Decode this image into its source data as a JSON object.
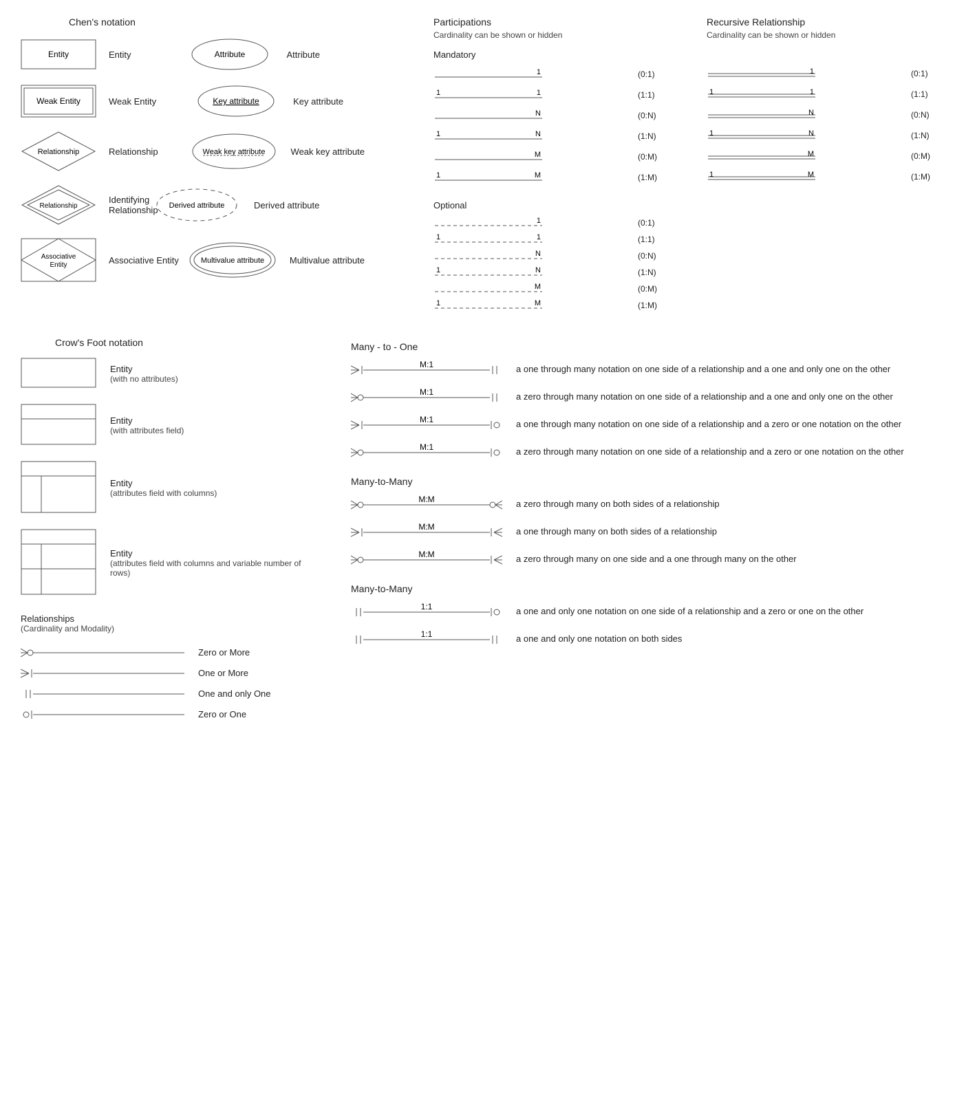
{
  "chen": {
    "title": "Chen's notation",
    "items": [
      {
        "shape_text": "Entity",
        "label": "Entity"
      },
      {
        "shape_text": "Weak Entity",
        "label": "Weak Entity"
      },
      {
        "shape_text": "Relationship",
        "label": "Relationship"
      },
      {
        "shape_text": "Relationship",
        "label": "Identifying Relationship"
      },
      {
        "shape_text": "Associative\nEntity",
        "label": "Associative Entity"
      }
    ],
    "attrs": [
      {
        "shape_text": "Attribute",
        "label": "Attribute"
      },
      {
        "shape_text": "Key attribute",
        "label": "Key attribute"
      },
      {
        "shape_text": "Weak key attribute",
        "label": "Weak key attribute"
      },
      {
        "shape_text": "Derived attribute",
        "label": "Derived attribute"
      },
      {
        "shape_text": "Multivalue attribute",
        "label": "Multivalue attribute"
      }
    ]
  },
  "participations": {
    "title": "Participations",
    "subtitle": "Cardinality can be shown or hidden",
    "mandatory_title": "Mandatory",
    "optional_title": "Optional",
    "rows": [
      {
        "left": "",
        "right": "1",
        "card": "(0:1)"
      },
      {
        "left": "1",
        "right": "1",
        "card": "(1:1)"
      },
      {
        "left": "",
        "right": "N",
        "card": "(0:N)"
      },
      {
        "left": "1",
        "right": "N",
        "card": "(1:N)"
      },
      {
        "left": "",
        "right": "M",
        "card": "(0:M)"
      },
      {
        "left": "1",
        "right": "M",
        "card": "(1:M)"
      }
    ],
    "opt_rows": [
      {
        "left": "",
        "right": "1",
        "card": "(0:1)"
      },
      {
        "left": "1",
        "right": "1",
        "card": "(1:1)"
      },
      {
        "left": "",
        "right": "N",
        "card": "(0:N)"
      },
      {
        "left": "1",
        "right": "N",
        "card": "(1:N)"
      },
      {
        "left": "",
        "right": "M",
        "card": "(0:M)"
      },
      {
        "left": "1",
        "right": "M",
        "card": "(1:M)"
      }
    ]
  },
  "recursive": {
    "title": "Recursive Relationship",
    "subtitle": "Cardinality can be shown or hidden",
    "rows": [
      {
        "left": "",
        "right": "1",
        "card": "(0:1)"
      },
      {
        "left": "1",
        "right": "1",
        "card": "(1:1)"
      },
      {
        "left": "",
        "right": "N",
        "card": "(0:N)"
      },
      {
        "left": "1",
        "right": "N",
        "card": "(1:N)"
      },
      {
        "left": "",
        "right": "M",
        "card": "(0:M)"
      },
      {
        "left": "1",
        "right": "M",
        "card": "(1:M)"
      }
    ]
  },
  "crows": {
    "title": "Crow's Foot notation",
    "entities": [
      {
        "title": "Entity",
        "sub": "(with no attributes)"
      },
      {
        "title": "Entity",
        "sub": "(with attributes field)"
      },
      {
        "title": "Entity",
        "sub": "(attributes field with columns)"
      },
      {
        "title": "Entity",
        "sub": "(attributes field with columns and variable number of rows)"
      }
    ],
    "rel_title": "Relationships",
    "rel_sub": "(Cardinality and Modality)",
    "basic": [
      {
        "label": "Zero or More"
      },
      {
        "label": "One or More"
      },
      {
        "label": "One and only One"
      },
      {
        "label": "Zero or One"
      }
    ],
    "m1": {
      "title": "Many - to - One",
      "rows": [
        {
          "ratio": "M:1",
          "desc": "a one through many notation on one side of a relationship and a one and only one on the other"
        },
        {
          "ratio": "M:1",
          "desc": "a zero through many notation on one side of a relationship and a one and only one on the other"
        },
        {
          "ratio": "M:1",
          "desc": "a one through many notation on one side of a relationship and a zero or one notation on the other"
        },
        {
          "ratio": "M:1",
          "desc": "a zero through many notation on one side of a relationship and a zero or one notation on the other"
        }
      ]
    },
    "mm": {
      "title": "Many-to-Many",
      "rows": [
        {
          "ratio": "M:M",
          "desc": "a zero through many on both sides of a relationship"
        },
        {
          "ratio": "M:M",
          "desc": "a one through many on both sides of a relationship"
        },
        {
          "ratio": "M:M",
          "desc": "a zero through many on one side and a one through many on the other"
        }
      ]
    },
    "oo": {
      "title": "Many-to-Many",
      "rows": [
        {
          "ratio": "1:1",
          "desc": "a one and only one notation on one side of a relationship and a zero or one on the other"
        },
        {
          "ratio": "1:1",
          "desc": "a one and only one notation on both sides"
        }
      ]
    }
  }
}
